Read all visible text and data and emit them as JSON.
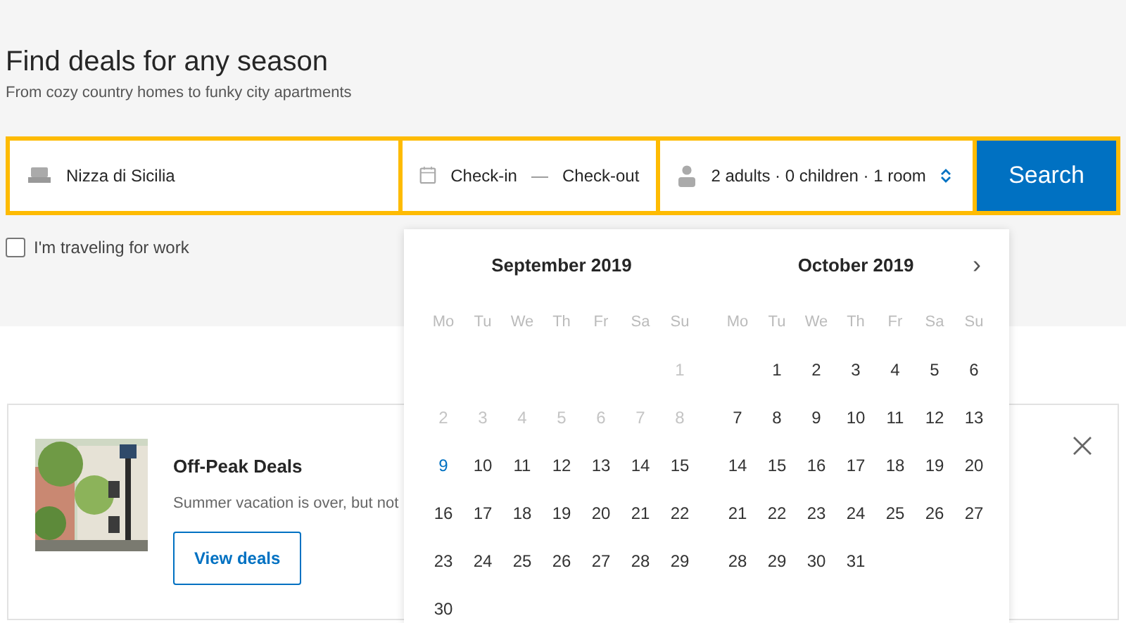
{
  "hero": {
    "title": "Find deals for any season",
    "subtitle": "From cozy country homes to funky city apartments"
  },
  "search_bar": {
    "destination": "Nizza di Sicilia",
    "check_in": "Check-in",
    "dash": "—",
    "check_out": "Check-out",
    "guests": "2 adults · 0 children · 1 room",
    "button": "Search"
  },
  "work_checkbox": {
    "label": "I'm traveling for work",
    "checked": false
  },
  "calendar": {
    "next": "›",
    "months": [
      {
        "title": "September 2019",
        "weekdays": [
          "Mo",
          "Tu",
          "We",
          "Th",
          "Fr",
          "Sa",
          "Su"
        ],
        "weeks": [
          {
            "kind": "first",
            "days": [
              {
                "label": "1",
                "kind": "past"
              }
            ]
          },
          {
            "kind": "week",
            "days": [
              {
                "label": "2",
                "kind": "past"
              },
              {
                "label": "3",
                "kind": "past"
              },
              {
                "label": "4",
                "kind": "past"
              },
              {
                "label": "5",
                "kind": "past"
              },
              {
                "label": "6",
                "kind": "past"
              },
              {
                "label": "7",
                "kind": "past"
              },
              {
                "label": "8",
                "kind": "past"
              }
            ]
          },
          {
            "kind": "week",
            "days": [
              {
                "label": "9",
                "kind": "today"
              },
              {
                "label": "10",
                "kind": "open"
              },
              {
                "label": "11",
                "kind": "open"
              },
              {
                "label": "12",
                "kind": "open"
              },
              {
                "label": "13",
                "kind": "open"
              },
              {
                "label": "14",
                "kind": "open"
              },
              {
                "label": "15",
                "kind": "open"
              }
            ]
          },
          {
            "kind": "week",
            "days": [
              {
                "label": "16",
                "kind": "open"
              },
              {
                "label": "17",
                "kind": "open"
              },
              {
                "label": "18",
                "kind": "open"
              },
              {
                "label": "19",
                "kind": "open"
              },
              {
                "label": "20",
                "kind": "open"
              },
              {
                "label": "21",
                "kind": "open"
              },
              {
                "label": "22",
                "kind": "open"
              }
            ]
          },
          {
            "kind": "week",
            "days": [
              {
                "label": "23",
                "kind": "open"
              },
              {
                "label": "24",
                "kind": "open"
              },
              {
                "label": "25",
                "kind": "open"
              },
              {
                "label": "26",
                "kind": "open"
              },
              {
                "label": "27",
                "kind": "open"
              },
              {
                "label": "28",
                "kind": "open"
              },
              {
                "label": "29",
                "kind": "open"
              }
            ]
          },
          {
            "kind": "week",
            "days": [
              {
                "label": "30",
                "kind": "open"
              }
            ]
          }
        ]
      },
      {
        "title": "October 2019",
        "weekdays": [
          "Mo",
          "Tu",
          "We",
          "Th",
          "Fr",
          "Sa",
          "Su"
        ],
        "weeks": [
          {
            "kind": "first",
            "days": [
              {
                "label": "1",
                "kind": "open"
              },
              {
                "label": "2",
                "kind": "open"
              },
              {
                "label": "3",
                "kind": "open"
              },
              {
                "label": "4",
                "kind": "open"
              },
              {
                "label": "5",
                "kind": "open"
              },
              {
                "label": "6",
                "kind": "open"
              }
            ]
          },
          {
            "kind": "week",
            "days": [
              {
                "label": "7",
                "kind": "open"
              },
              {
                "label": "8",
                "kind": "open"
              },
              {
                "label": "9",
                "kind": "open"
              },
              {
                "label": "10",
                "kind": "open"
              },
              {
                "label": "11",
                "kind": "open"
              },
              {
                "label": "12",
                "kind": "open"
              },
              {
                "label": "13",
                "kind": "open"
              }
            ]
          },
          {
            "kind": "week",
            "days": [
              {
                "label": "14",
                "kind": "open"
              },
              {
                "label": "15",
                "kind": "open"
              },
              {
                "label": "16",
                "kind": "open"
              },
              {
                "label": "17",
                "kind": "open"
              },
              {
                "label": "18",
                "kind": "open"
              },
              {
                "label": "19",
                "kind": "open"
              },
              {
                "label": "20",
                "kind": "open"
              }
            ]
          },
          {
            "kind": "week",
            "days": [
              {
                "label": "21",
                "kind": "open"
              },
              {
                "label": "22",
                "kind": "open"
              },
              {
                "label": "23",
                "kind": "open"
              },
              {
                "label": "24",
                "kind": "open"
              },
              {
                "label": "25",
                "kind": "open"
              },
              {
                "label": "26",
                "kind": "open"
              },
              {
                "label": "27",
                "kind": "open"
              }
            ]
          },
          {
            "kind": "week",
            "days": [
              {
                "label": "28",
                "kind": "open"
              },
              {
                "label": "29",
                "kind": "open"
              },
              {
                "label": "30",
                "kind": "open"
              },
              {
                "label": "31",
                "kind": "open"
              }
            ]
          }
        ]
      }
    ]
  },
  "deal_card": {
    "title": "Off-Peak Deals",
    "text": "Summer vacation is over, but not",
    "button": "View deals"
  }
}
